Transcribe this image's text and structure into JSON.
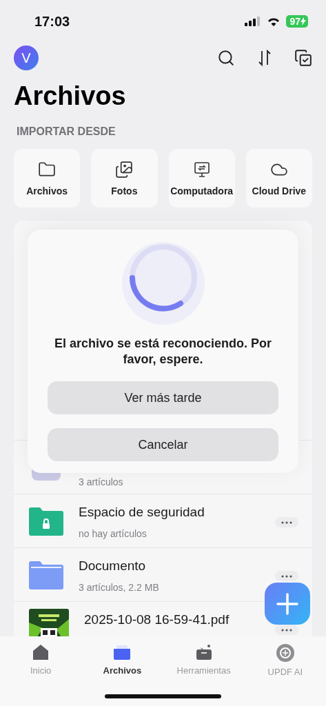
{
  "status_bar": {
    "time": "17:03",
    "battery": "97"
  },
  "header": {
    "avatar": "V",
    "title": "Archivos"
  },
  "import": {
    "heading": "IMPORTAR DESDE",
    "sources": [
      {
        "label": "Archivos",
        "kind": "folder"
      },
      {
        "label": "Fotos",
        "kind": "photos"
      },
      {
        "label": "Computadora",
        "kind": "computer"
      },
      {
        "label": "Cloud Drive",
        "kind": "cloud"
      }
    ]
  },
  "files": [
    {
      "kind": "lavender",
      "subtitle": "3 artículos"
    },
    {
      "kind": "secure",
      "name": "Espacio de seguridad",
      "subtitle": "no hay artículos"
    },
    {
      "kind": "folder",
      "name": "Documento",
      "subtitle": "3 artículos, 2.2 MB"
    },
    {
      "kind": "pdf",
      "name": "2025-10-08 16-59-41.pdf"
    }
  ],
  "dialog": {
    "message": "El archivo se está reconociendo. Por favor, espere.",
    "buttons": [
      "Ver más tarde",
      "Cancelar"
    ]
  },
  "tabs": [
    {
      "label": "Inicio",
      "kind": "home",
      "selected": false
    },
    {
      "label": "Archivos",
      "kind": "files",
      "selected": true
    },
    {
      "label": "Herramientas",
      "kind": "tools",
      "selected": false
    },
    {
      "label": "UPDF AI",
      "kind": "ai",
      "selected": false
    }
  ]
}
